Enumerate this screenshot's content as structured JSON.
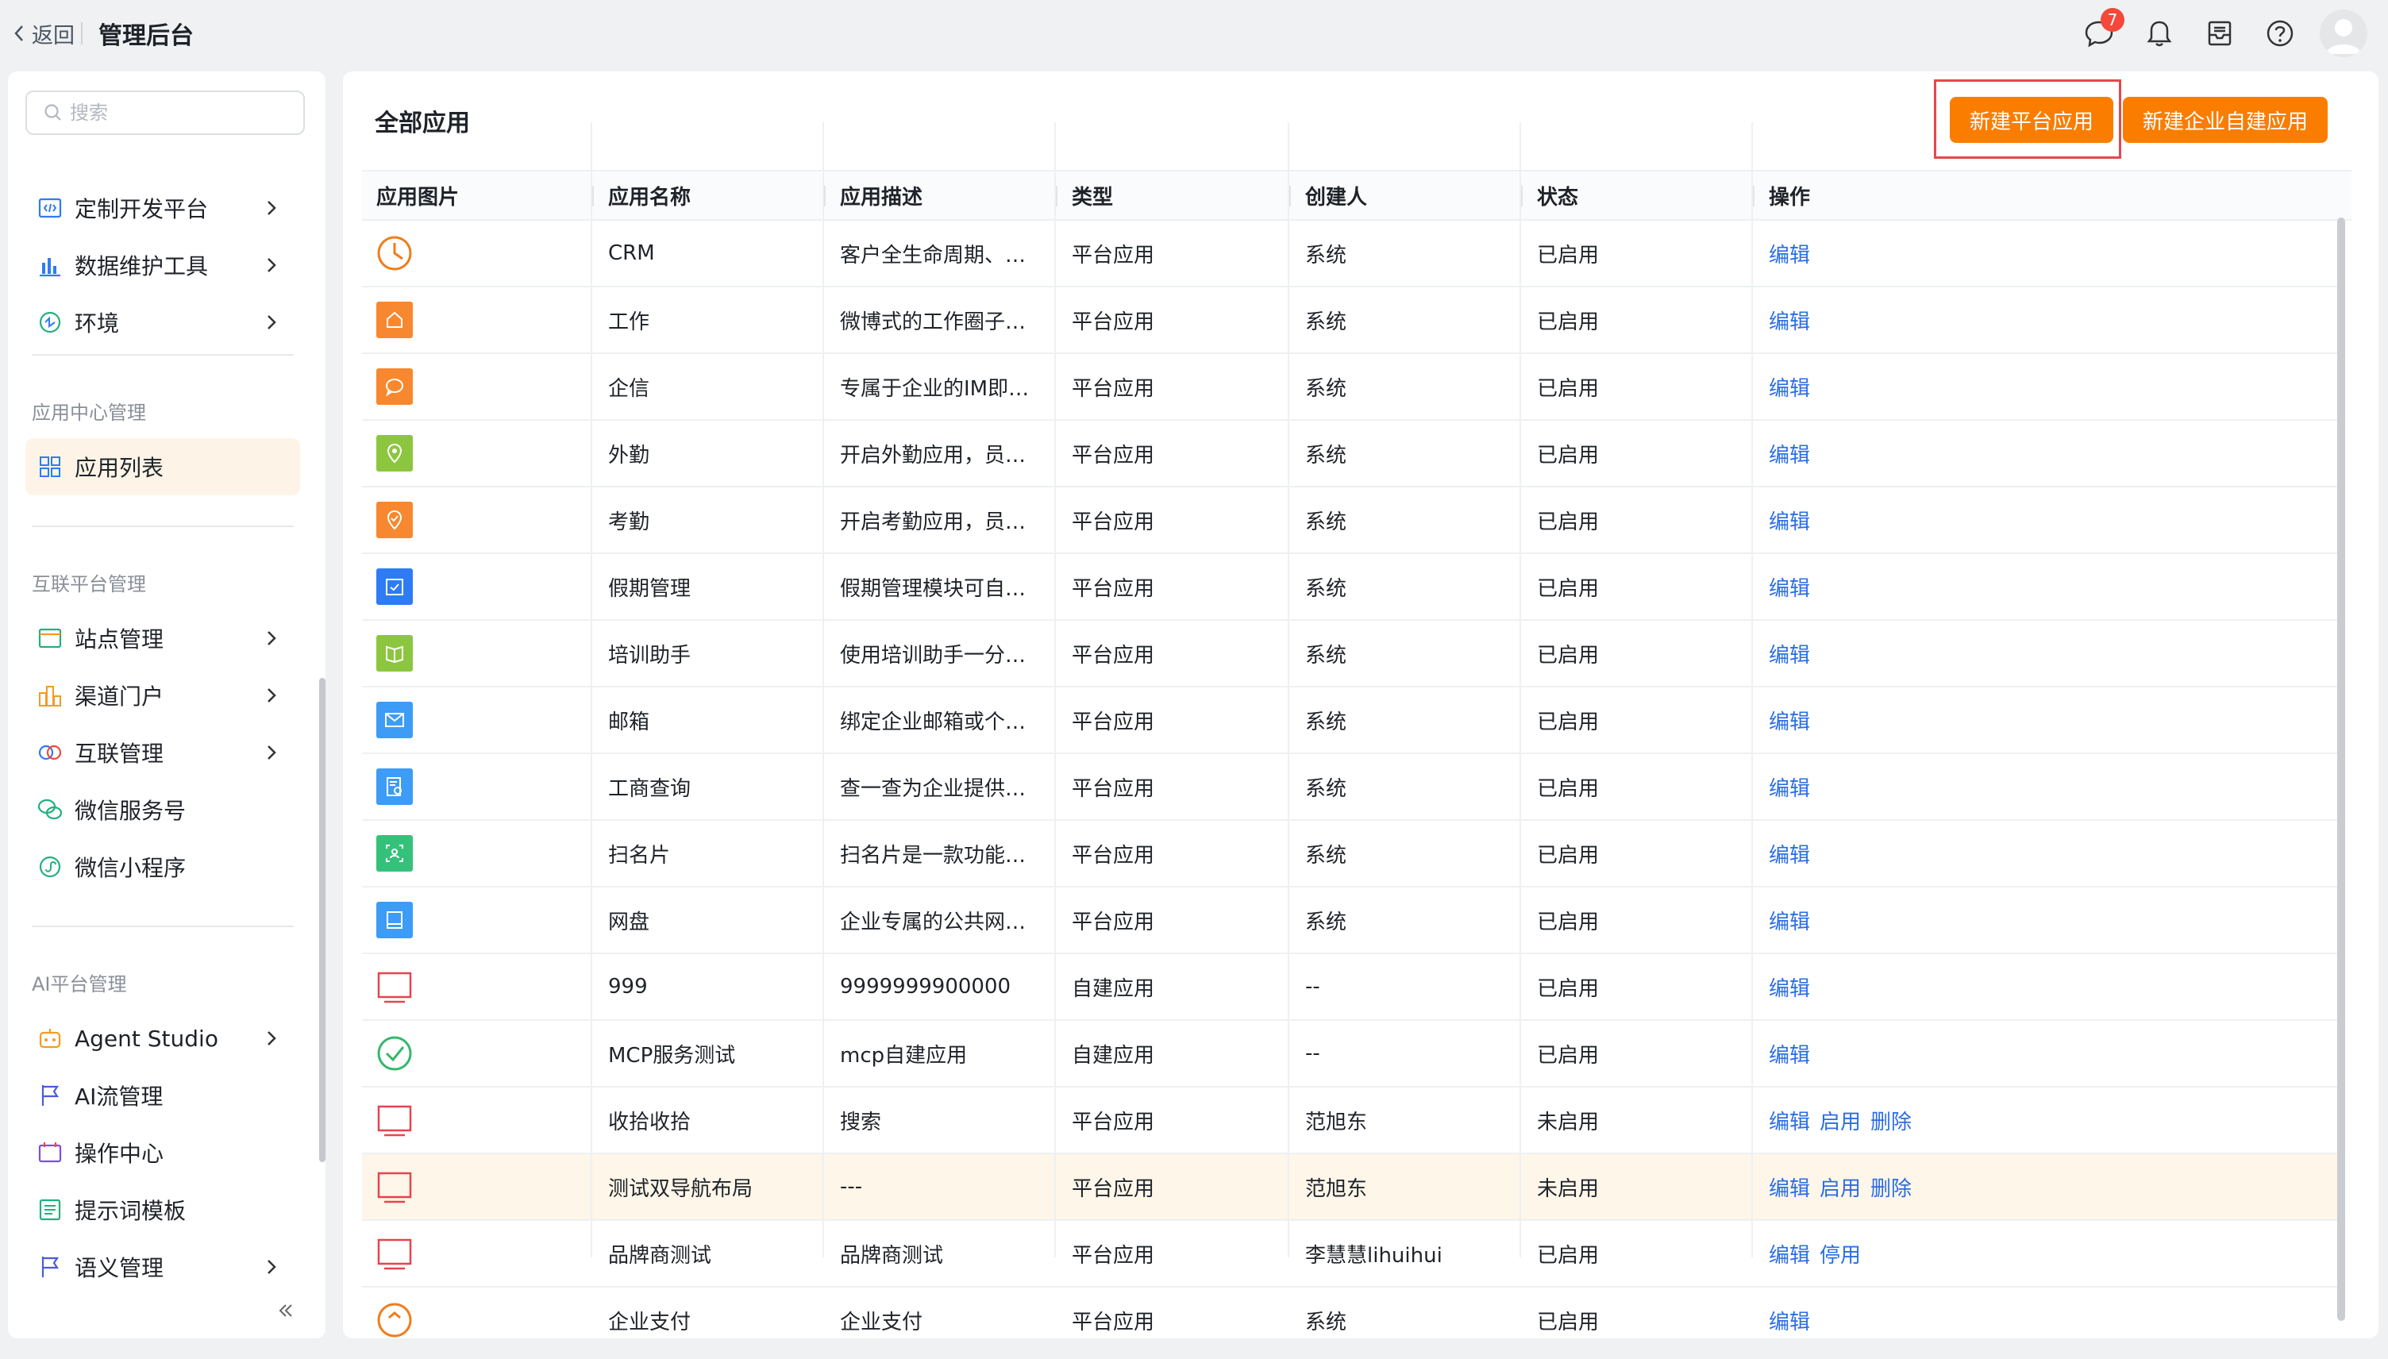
{
  "header": {
    "back_label": "返回",
    "title": "管理后台",
    "notification_count": "7",
    "icons": [
      "message-icon",
      "bell-icon",
      "inbox-icon",
      "help-icon",
      "avatar"
    ]
  },
  "sidebar": {
    "search_placeholder": "搜索",
    "items_top": [
      {
        "label": "定制开发平台",
        "icon": "code-icon"
      },
      {
        "label": "数据维护工具",
        "icon": "chart-icon"
      },
      {
        "label": "环境",
        "icon": "environment-icon"
      }
    ],
    "section_app": "应用中心管理",
    "app_list": "应用列表",
    "section_interconnect": "互联平台管理",
    "items_interconnect": [
      {
        "label": "站点管理",
        "icon": "site-icon"
      },
      {
        "label": "渠道门户",
        "icon": "channel-icon"
      },
      {
        "label": "互联管理",
        "icon": "link-icon"
      },
      {
        "label": "微信服务号",
        "icon": "wechat-icon"
      },
      {
        "label": "微信小程序",
        "icon": "miniprogram-icon"
      }
    ],
    "section_ai": "AI平台管理",
    "items_ai": [
      {
        "label": "Agent Studio",
        "icon": "robot-icon"
      },
      {
        "label": "AI流管理",
        "icon": "flag-icon"
      },
      {
        "label": "操作中心",
        "icon": "operation-icon"
      },
      {
        "label": "提示词模板",
        "icon": "template-icon"
      },
      {
        "label": "语义管理",
        "icon": "flag-icon"
      }
    ]
  },
  "main": {
    "title": "全部应用",
    "btn_new_platform": "新建平台应用",
    "btn_new_custom": "新建企业自建应用",
    "columns": [
      "应用图片",
      "应用名称",
      "应用描述",
      "类型",
      "创建人",
      "状态",
      "操作"
    ],
    "rows": [
      {
        "icon": "crm",
        "name": "CRM",
        "desc": "客户全生命周期、…",
        "type": "平台应用",
        "creator": "系统",
        "status": "已启用",
        "ops": [
          "编辑"
        ]
      },
      {
        "icon": "work",
        "name": "工作",
        "desc": "微博式的工作圈子…",
        "type": "平台应用",
        "creator": "系统",
        "status": "已启用",
        "ops": [
          "编辑"
        ]
      },
      {
        "icon": "im",
        "name": "企信",
        "desc": "专属于企业的IM即…",
        "type": "平台应用",
        "creator": "系统",
        "status": "已启用",
        "ops": [
          "编辑"
        ]
      },
      {
        "icon": "field",
        "name": "外勤",
        "desc": "开启外勤应用，员…",
        "type": "平台应用",
        "creator": "系统",
        "status": "已启用",
        "ops": [
          "编辑"
        ]
      },
      {
        "icon": "attendance",
        "name": "考勤",
        "desc": "开启考勤应用，员…",
        "type": "平台应用",
        "creator": "系统",
        "status": "已启用",
        "ops": [
          "编辑"
        ]
      },
      {
        "icon": "holiday",
        "name": "假期管理",
        "desc": "假期管理模块可自…",
        "type": "平台应用",
        "creator": "系统",
        "status": "已启用",
        "ops": [
          "编辑"
        ]
      },
      {
        "icon": "training",
        "name": "培训助手",
        "desc": "使用培训助手一分…",
        "type": "平台应用",
        "creator": "系统",
        "status": "已启用",
        "ops": [
          "编辑"
        ]
      },
      {
        "icon": "mail",
        "name": "邮箱",
        "desc": "绑定企业邮箱或个…",
        "type": "平台应用",
        "creator": "系统",
        "status": "已启用",
        "ops": [
          "编辑"
        ]
      },
      {
        "icon": "business",
        "name": "工商查询",
        "desc": "查一查为企业提供…",
        "type": "平台应用",
        "creator": "系统",
        "status": "已启用",
        "ops": [
          "编辑"
        ]
      },
      {
        "icon": "card",
        "name": "扫名片",
        "desc": "扫名片是一款功能…",
        "type": "平台应用",
        "creator": "系统",
        "status": "已启用",
        "ops": [
          "编辑"
        ]
      },
      {
        "icon": "disk",
        "name": "网盘",
        "desc": "企业专属的公共网…",
        "type": "平台应用",
        "creator": "系统",
        "status": "已启用",
        "ops": [
          "编辑"
        ]
      },
      {
        "icon": "default",
        "name": "999",
        "desc": "9999999900000",
        "type": "自建应用",
        "creator": "--",
        "status": "已启用",
        "ops": [
          "编辑"
        ]
      },
      {
        "icon": "check",
        "name": "MCP服务测试",
        "desc": "mcp自建应用",
        "type": "自建应用",
        "creator": "--",
        "status": "已启用",
        "ops": [
          "编辑"
        ]
      },
      {
        "icon": "default",
        "name": "收拾收拾",
        "desc": "搜索",
        "type": "平台应用",
        "creator": "范旭东",
        "status": "未启用",
        "ops": [
          "编辑",
          "启用",
          "删除"
        ]
      },
      {
        "icon": "default",
        "name": "测试双导航布局",
        "desc": "---",
        "type": "平台应用",
        "creator": "范旭东",
        "status": "未启用",
        "ops": [
          "编辑",
          "启用",
          "删除"
        ]
      },
      {
        "icon": "default",
        "name": "品牌商测试",
        "desc": "品牌商测试",
        "type": "平台应用",
        "creator": "李慧慧lihuihui",
        "status": "已启用",
        "ops": [
          "编辑",
          "停用"
        ]
      },
      {
        "icon": "pay",
        "name": "企业支付",
        "desc": "企业支付",
        "type": "平台应用",
        "creator": "系统",
        "status": "已启用",
        "ops": [
          "编辑"
        ]
      }
    ],
    "highlighted_row": 14
  },
  "colors": {
    "accent": "#fa7d00",
    "link": "#2b6de5",
    "active_bg": "#fdf4e7",
    "highlight": "#e5484d"
  }
}
